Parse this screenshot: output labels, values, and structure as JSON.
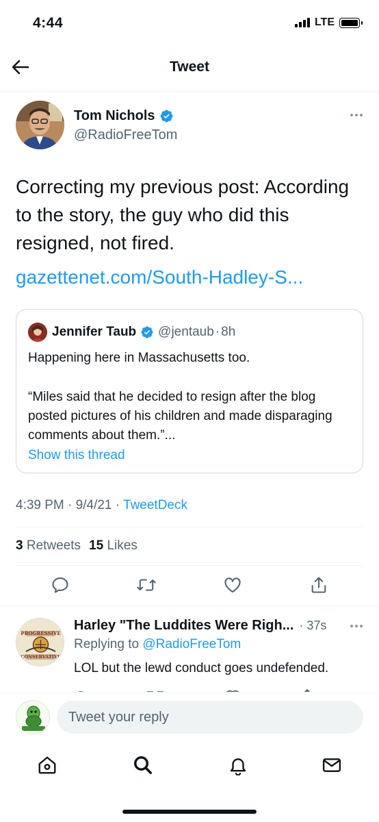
{
  "status_bar": {
    "time": "4:44",
    "network": "LTE"
  },
  "header": {
    "title": "Tweet"
  },
  "tweet": {
    "author_name": "Tom Nichols",
    "author_handle": "@RadioFreeTom",
    "text": "Correcting my previous post: According to the story, the guy who did this resigned, not fired.",
    "link": "gazettenet.com/South-Hadley-S...",
    "quote": {
      "author_name": "Jennifer Taub",
      "author_handle": "@jentaub",
      "separator": "·",
      "time": "8h",
      "text_1": "Happening here in Massachusetts too.",
      "text_2": "“Miles said that he decided to resign after the blog posted pictures of his children and made disparaging comments about them.”...",
      "show_thread": "Show this thread"
    },
    "timestamp": "4:39 PM · 9/4/21 · ",
    "source": "TweetDeck",
    "retweets_count": "3",
    "retweets_label": "Retweets",
    "likes_count": "15",
    "likes_label": "Likes"
  },
  "reply": {
    "author_name": "Harley \"The Luddites Were Righ...",
    "time": "· 37s",
    "replying_prefix": "Replying to ",
    "replying_to": "@RadioFreeTom",
    "text": "LOL but the lewd conduct goes undefended."
  },
  "compose": {
    "placeholder": "Tweet your reply"
  },
  "colors": {
    "accent": "#1d9bf0",
    "text": "#0f1419",
    "secondary": "#536471"
  },
  "icons": [
    "back-arrow-icon",
    "verified-badge-icon",
    "more-icon",
    "reply-icon",
    "retweet-icon",
    "like-icon",
    "share-icon",
    "home-icon",
    "search-icon",
    "notifications-icon",
    "messages-icon"
  ]
}
